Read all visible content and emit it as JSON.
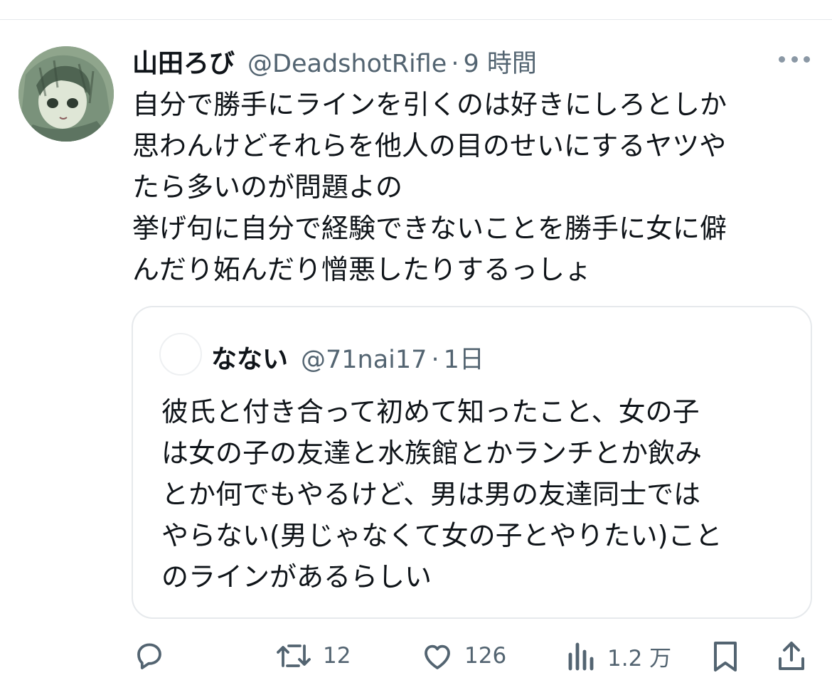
{
  "tweet": {
    "author": {
      "display_name": "山田ろび",
      "handle": "@DeadshotRifle",
      "separator": "·",
      "time": "9 時間"
    },
    "text_lines": [
      "自分で勝手にラインを引くのは好きにしろとしか",
      "思わんけどそれらを他人の目のせいにするヤツや",
      "たら多いのが問題よの",
      "挙げ句に自分で経験できないことを勝手に女に僻",
      "んだり妬んだり憎悪したりするっしょ"
    ]
  },
  "quote": {
    "author": {
      "display_name": "なない",
      "handle": "@71nai17",
      "separator": "·",
      "time": "1日"
    },
    "text_lines": [
      "彼氏と付き合って初めて知ったこと、女の子",
      "は女の子の友達と水族館とかランチとか飲み",
      "とか何でもやるけど、男は男の友達同士では",
      "やらない(男じゃなくて女の子とやりたい)こと",
      "のラインがあるらしい"
    ]
  },
  "actions": {
    "reply": {
      "icon": "reply-icon",
      "count": ""
    },
    "retweet": {
      "icon": "retweet-icon",
      "count": "12"
    },
    "like": {
      "icon": "heart-icon",
      "count": "126"
    },
    "views": {
      "icon": "views-icon",
      "count": "1.2 万"
    },
    "bookmark": {
      "icon": "bookmark-icon"
    },
    "share": {
      "icon": "share-icon"
    }
  },
  "colors": {
    "text_primary": "#0f1419",
    "text_secondary": "#536471",
    "border": "#e6e9ec"
  }
}
